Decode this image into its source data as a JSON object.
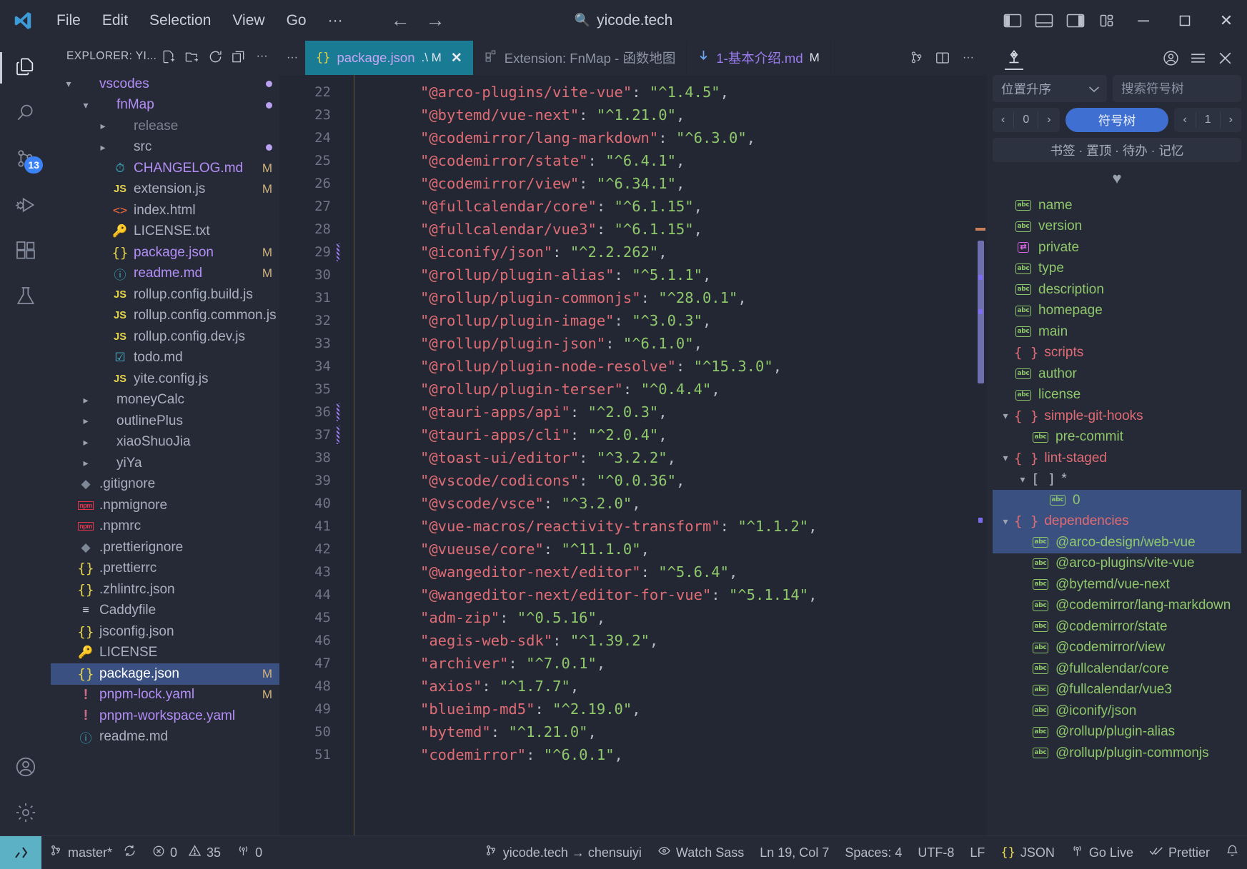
{
  "titlebar": {
    "menus": [
      "File",
      "Edit",
      "Selection",
      "View",
      "Go",
      "···"
    ],
    "back_icon": "←",
    "forward_icon": "→",
    "search_title": "yicode.tech",
    "search_icon": "search-icon",
    "minimize": "─",
    "maximize": "☐",
    "close": "✕"
  },
  "activitybar": {
    "items": [
      {
        "name": "explorer",
        "active": true,
        "badge": ""
      },
      {
        "name": "search",
        "active": false,
        "badge": ""
      },
      {
        "name": "source-control",
        "active": false,
        "badge": "13"
      },
      {
        "name": "run-and-debug",
        "active": false,
        "badge": ""
      },
      {
        "name": "extensions",
        "active": false,
        "badge": ""
      },
      {
        "name": "testing",
        "active": false,
        "badge": ""
      }
    ],
    "bottom": [
      {
        "name": "accounts"
      },
      {
        "name": "settings"
      }
    ]
  },
  "sidebar": {
    "title": "EXPLORER: YI...",
    "actions": [
      "new-file",
      "new-folder",
      "refresh",
      "collapse-all",
      "more-actions"
    ],
    "tree": [
      {
        "label": "vscodes",
        "indent": 0,
        "chev": "down",
        "icon": "none",
        "color": "#b48ef7",
        "badge": "dot"
      },
      {
        "label": "fnMap",
        "indent": 1,
        "chev": "down",
        "icon": "none",
        "color": "#b48ef7",
        "badge": "dot"
      },
      {
        "label": "release",
        "indent": 2,
        "chev": "right",
        "icon": "none",
        "color": "#7a8292",
        "badge": ""
      },
      {
        "label": "src",
        "indent": 2,
        "chev": "right",
        "icon": "none",
        "color": "#a9b0bf",
        "badge": "dot"
      },
      {
        "label": "CHANGELOG.md",
        "indent": 2,
        "chev": "none",
        "icon": "md-clock",
        "color": "#b48ef7",
        "badge": "M"
      },
      {
        "label": "extension.js",
        "indent": 2,
        "chev": "none",
        "icon": "js",
        "color": "#a9b0bf",
        "badge": "M"
      },
      {
        "label": "index.html",
        "indent": 2,
        "chev": "none",
        "icon": "html",
        "color": "#a9b0bf",
        "badge": ""
      },
      {
        "label": "LICENSE.txt",
        "indent": 2,
        "chev": "none",
        "icon": "key",
        "color": "#a9b0bf",
        "badge": ""
      },
      {
        "label": "package.json",
        "indent": 2,
        "chev": "none",
        "icon": "json",
        "color": "#b48ef7",
        "badge": "M"
      },
      {
        "label": "readme.md",
        "indent": 2,
        "chev": "none",
        "icon": "md-info",
        "color": "#b48ef7",
        "badge": "M"
      },
      {
        "label": "rollup.config.build.js",
        "indent": 2,
        "chev": "none",
        "icon": "js",
        "color": "#a9b0bf",
        "badge": ""
      },
      {
        "label": "rollup.config.common.js",
        "indent": 2,
        "chev": "none",
        "icon": "js",
        "color": "#a9b0bf",
        "badge": ""
      },
      {
        "label": "rollup.config.dev.js",
        "indent": 2,
        "chev": "none",
        "icon": "js",
        "color": "#a9b0bf",
        "badge": ""
      },
      {
        "label": "todo.md",
        "indent": 2,
        "chev": "none",
        "icon": "md-check",
        "color": "#a9b0bf",
        "badge": ""
      },
      {
        "label": "yite.config.js",
        "indent": 2,
        "chev": "none",
        "icon": "js",
        "color": "#a9b0bf",
        "badge": ""
      },
      {
        "label": "moneyCalc",
        "indent": 1,
        "chev": "right",
        "icon": "none",
        "color": "#a9b0bf",
        "badge": ""
      },
      {
        "label": "outlinePlus",
        "indent": 1,
        "chev": "right",
        "icon": "none",
        "color": "#a9b0bf",
        "badge": ""
      },
      {
        "label": "xiaoShuoJia",
        "indent": 1,
        "chev": "right",
        "icon": "none",
        "color": "#a9b0bf",
        "badge": ""
      },
      {
        "label": "yiYa",
        "indent": 1,
        "chev": "right",
        "icon": "none",
        "color": "#a9b0bf",
        "badge": ""
      },
      {
        "label": ".gitignore",
        "indent": 0,
        "chev": "none",
        "icon": "git",
        "color": "#a9b0bf",
        "badge": ""
      },
      {
        "label": ".npmignore",
        "indent": 0,
        "chev": "none",
        "icon": "npm",
        "color": "#a9b0bf",
        "badge": ""
      },
      {
        "label": ".npmrc",
        "indent": 0,
        "chev": "none",
        "icon": "npm",
        "color": "#a9b0bf",
        "badge": ""
      },
      {
        "label": ".prettierignore",
        "indent": 0,
        "chev": "none",
        "icon": "git",
        "color": "#a9b0bf",
        "badge": ""
      },
      {
        "label": ".prettierrc",
        "indent": 0,
        "chev": "none",
        "icon": "json",
        "color": "#a9b0bf",
        "badge": ""
      },
      {
        "label": ".zhlintrc.json",
        "indent": 0,
        "chev": "none",
        "icon": "json",
        "color": "#a9b0bf",
        "badge": ""
      },
      {
        "label": "Caddyfile",
        "indent": 0,
        "chev": "none",
        "icon": "caddy",
        "color": "#a9b0bf",
        "badge": ""
      },
      {
        "label": "jsconfig.json",
        "indent": 0,
        "chev": "none",
        "icon": "json",
        "color": "#a9b0bf",
        "badge": ""
      },
      {
        "label": "LICENSE",
        "indent": 0,
        "chev": "none",
        "icon": "key",
        "color": "#a9b0bf",
        "badge": ""
      },
      {
        "label": "package.json",
        "indent": 0,
        "chev": "none",
        "icon": "json",
        "color": "#ffffff",
        "badge": "M",
        "selected": true
      },
      {
        "label": "pnpm-lock.yaml",
        "indent": 0,
        "chev": "none",
        "icon": "yaml",
        "color": "#b48ef7",
        "badge": "M"
      },
      {
        "label": "pnpm-workspace.yaml",
        "indent": 0,
        "chev": "none",
        "icon": "yaml",
        "color": "#b48ef7",
        "badge": ""
      },
      {
        "label": "readme.md",
        "indent": 0,
        "chev": "none",
        "icon": "md-info",
        "color": "#a9b0bf",
        "badge": ""
      }
    ]
  },
  "tabs": [
    {
      "icon": "json-icon",
      "name": "package.json",
      "meta": ".\\ M",
      "active": true,
      "closable": true
    },
    {
      "icon": "extension-icon",
      "name": "Extension: FnMap - 函数地图",
      "meta": "",
      "active": false,
      "closable": false
    },
    {
      "icon": "markdown-download-icon",
      "name": "1-基本介绍.md",
      "meta": "M",
      "active": false,
      "closable": false
    }
  ],
  "tab_actions": [
    "source-control-icon",
    "split-editor-icon",
    "more-actions-icon"
  ],
  "editor": {
    "first_line": 22,
    "git_modified_lines": [
      29,
      36,
      37
    ],
    "lines": [
      {
        "n": 22,
        "key": "\"@arco-plugins/vite-vue\"",
        "val": "\"^1.4.5\""
      },
      {
        "n": 23,
        "key": "\"@bytemd/vue-next\"",
        "val": "\"^1.21.0\""
      },
      {
        "n": 24,
        "key": "\"@codemirror/lang-markdown\"",
        "val": "\"^6.3.0\""
      },
      {
        "n": 25,
        "key": "\"@codemirror/state\"",
        "val": "\"^6.4.1\""
      },
      {
        "n": 26,
        "key": "\"@codemirror/view\"",
        "val": "\"^6.34.1\""
      },
      {
        "n": 27,
        "key": "\"@fullcalendar/core\"",
        "val": "\"^6.1.15\""
      },
      {
        "n": 28,
        "key": "\"@fullcalendar/vue3\"",
        "val": "\"^6.1.15\""
      },
      {
        "n": 29,
        "key": "\"@iconify/json\"",
        "val": "\"^2.2.262\""
      },
      {
        "n": 30,
        "key": "\"@rollup/plugin-alias\"",
        "val": "\"^5.1.1\""
      },
      {
        "n": 31,
        "key": "\"@rollup/plugin-commonjs\"",
        "val": "\"^28.0.1\""
      },
      {
        "n": 32,
        "key": "\"@rollup/plugin-image\"",
        "val": "\"^3.0.3\""
      },
      {
        "n": 33,
        "key": "\"@rollup/plugin-json\"",
        "val": "\"^6.1.0\""
      },
      {
        "n": 34,
        "key": "\"@rollup/plugin-node-resolve\"",
        "val": "\"^15.3.0\""
      },
      {
        "n": 35,
        "key": "\"@rollup/plugin-terser\"",
        "val": "\"^0.4.4\""
      },
      {
        "n": 36,
        "key": "\"@tauri-apps/api\"",
        "val": "\"^2.0.3\""
      },
      {
        "n": 37,
        "key": "\"@tauri-apps/cli\"",
        "val": "\"^2.0.4\""
      },
      {
        "n": 38,
        "key": "\"@toast-ui/editor\"",
        "val": "\"^3.2.2\""
      },
      {
        "n": 39,
        "key": "\"@vscode/codicons\"",
        "val": "\"^0.0.36\""
      },
      {
        "n": 40,
        "key": "\"@vscode/vsce\"",
        "val": "\"^3.2.0\""
      },
      {
        "n": 41,
        "key": "\"@vue-macros/reactivity-transform\"",
        "val": "\"^1.1.2\""
      },
      {
        "n": 42,
        "key": "\"@vueuse/core\"",
        "val": "\"^11.1.0\""
      },
      {
        "n": 43,
        "key": "\"@wangeditor-next/editor\"",
        "val": "\"^5.6.4\""
      },
      {
        "n": 44,
        "key": "\"@wangeditor-next/editor-for-vue\"",
        "val": "\"^5.1.14\""
      },
      {
        "n": 45,
        "key": "\"adm-zip\"",
        "val": "\"^0.5.16\""
      },
      {
        "n": 46,
        "key": "\"aegis-web-sdk\"",
        "val": "\"^1.39.2\""
      },
      {
        "n": 47,
        "key": "\"archiver\"",
        "val": "\"^7.0.1\""
      },
      {
        "n": 48,
        "key": "\"axios\"",
        "val": "\"^1.7.7\""
      },
      {
        "n": 49,
        "key": "\"blueimp-md5\"",
        "val": "\"^2.19.0\""
      },
      {
        "n": 50,
        "key": "\"bytemd\"",
        "val": "\"^1.21.0\""
      },
      {
        "n": 51,
        "key": "\"codemirror\"",
        "val": "\"^6.0.1\""
      }
    ]
  },
  "rightpanel": {
    "tab_icon": "fnmap-icon",
    "header_actions": [
      "account-icon",
      "menu-icon",
      "close-icon"
    ],
    "sort_label": "位置升序",
    "sort_chevron": "⌄",
    "search_placeholder": "搜索符号树",
    "search_value": "",
    "pager_left": {
      "prev": "‹",
      "count": "0",
      "next": "›"
    },
    "pill_label": "符号树",
    "pager_right": {
      "prev": "‹",
      "page": "1",
      "next": "›"
    },
    "banner": "书签 · 置顶 · 待办 · 记忆",
    "heart_icon": "♥",
    "symbols": [
      {
        "label": "name",
        "indent": 0,
        "chev": "none",
        "icon": "abc",
        "kind": "string"
      },
      {
        "label": "version",
        "indent": 0,
        "chev": "none",
        "icon": "abc",
        "kind": "string"
      },
      {
        "label": "private",
        "indent": 0,
        "chev": "none",
        "icon": "bool",
        "kind": "boolean"
      },
      {
        "label": "type",
        "indent": 0,
        "chev": "none",
        "icon": "abc",
        "kind": "string"
      },
      {
        "label": "description",
        "indent": 0,
        "chev": "none",
        "icon": "abc",
        "kind": "string"
      },
      {
        "label": "homepage",
        "indent": 0,
        "chev": "none",
        "icon": "abc",
        "kind": "string"
      },
      {
        "label": "main",
        "indent": 0,
        "chev": "none",
        "icon": "abc",
        "kind": "string"
      },
      {
        "label": "scripts",
        "indent": 0,
        "chev": "none",
        "icon": "obj",
        "kind": "object"
      },
      {
        "label": "author",
        "indent": 0,
        "chev": "none",
        "icon": "abc",
        "kind": "string"
      },
      {
        "label": "license",
        "indent": 0,
        "chev": "none",
        "icon": "abc",
        "kind": "string"
      },
      {
        "label": "simple-git-hooks",
        "indent": 0,
        "chev": "down",
        "icon": "obj",
        "kind": "object"
      },
      {
        "label": "pre-commit",
        "indent": 1,
        "chev": "none",
        "icon": "abc",
        "kind": "string"
      },
      {
        "label": "lint-staged",
        "indent": 0,
        "chev": "down",
        "icon": "obj",
        "kind": "object"
      },
      {
        "label": "*",
        "indent": 1,
        "chev": "down",
        "icon": "arr",
        "kind": "array"
      },
      {
        "label": "0",
        "indent": 2,
        "chev": "none",
        "icon": "abc",
        "kind": "string",
        "selected": true
      },
      {
        "label": "dependencies",
        "indent": 0,
        "chev": "down",
        "icon": "obj",
        "kind": "object",
        "selected": true
      },
      {
        "label": "@arco-design/web-vue",
        "indent": 1,
        "chev": "none",
        "icon": "abc",
        "kind": "string",
        "selected": true
      },
      {
        "label": "@arco-plugins/vite-vue",
        "indent": 1,
        "chev": "none",
        "icon": "abc",
        "kind": "string"
      },
      {
        "label": "@bytemd/vue-next",
        "indent": 1,
        "chev": "none",
        "icon": "abc",
        "kind": "string"
      },
      {
        "label": "@codemirror/lang-markdown",
        "indent": 1,
        "chev": "none",
        "icon": "abc",
        "kind": "string"
      },
      {
        "label": "@codemirror/state",
        "indent": 1,
        "chev": "none",
        "icon": "abc",
        "kind": "string"
      },
      {
        "label": "@codemirror/view",
        "indent": 1,
        "chev": "none",
        "icon": "abc",
        "kind": "string"
      },
      {
        "label": "@fullcalendar/core",
        "indent": 1,
        "chev": "none",
        "icon": "abc",
        "kind": "string"
      },
      {
        "label": "@fullcalendar/vue3",
        "indent": 1,
        "chev": "none",
        "icon": "abc",
        "kind": "string"
      },
      {
        "label": "@iconify/json",
        "indent": 1,
        "chev": "none",
        "icon": "abc",
        "kind": "string"
      },
      {
        "label": "@rollup/plugin-alias",
        "indent": 1,
        "chev": "none",
        "icon": "abc",
        "kind": "string"
      },
      {
        "label": "@rollup/plugin-commonjs",
        "indent": 1,
        "chev": "none",
        "icon": "abc",
        "kind": "string"
      }
    ]
  },
  "statusbar": {
    "remote_icon": "remote-window-icon",
    "left": [
      {
        "icon": "source-control-icon",
        "label": "master*"
      },
      {
        "icon": "sync-icon",
        "label": ""
      },
      {
        "icon": "error-icon",
        "label": "0"
      },
      {
        "icon": "warning-icon",
        "label": "35"
      },
      {
        "icon": "radio-tower-icon",
        "label": "0"
      }
    ],
    "right": [
      {
        "icon": "source-control-icon",
        "label": "yicode.tech → chensuiyi"
      },
      {
        "icon": "eye-icon",
        "label": "Watch Sass"
      },
      {
        "icon": "",
        "label": "Ln 19, Col 7"
      },
      {
        "icon": "",
        "label": "Spaces: 4"
      },
      {
        "icon": "",
        "label": "UTF-8"
      },
      {
        "icon": "",
        "label": "LF"
      },
      {
        "icon": "json-icon",
        "label": "JSON"
      },
      {
        "icon": "broadcast-icon",
        "label": "Go Live"
      },
      {
        "icon": "check-all-icon",
        "label": "Prettier"
      },
      {
        "icon": "bell-icon",
        "label": ""
      }
    ]
  },
  "colors": {
    "accent": "#3f6fd0",
    "tab_active": "#1a7b94",
    "selection": "#3a5080",
    "bg": "#222733",
    "chrome": "#252a36",
    "string_green": "#8fc76b",
    "key_red": "#e06c75",
    "folder_purple": "#b48ef7"
  }
}
